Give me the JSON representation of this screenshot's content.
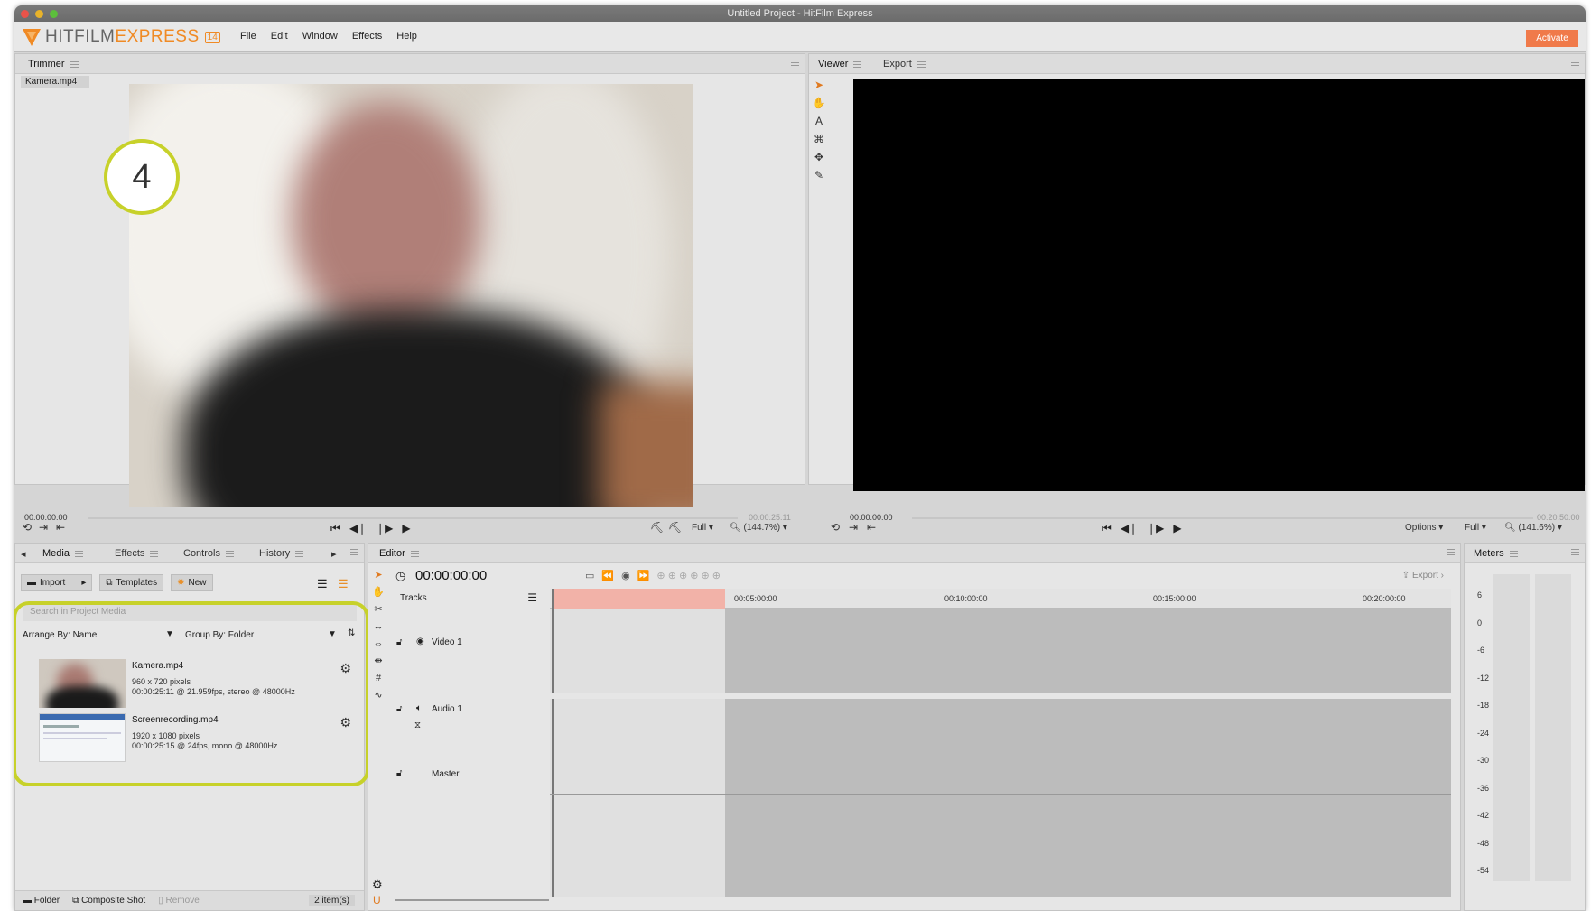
{
  "window": {
    "title": "Untitled Project - HitFilm Express"
  },
  "app": {
    "logo_main": "HITFILM",
    "logo_accent": "EXPRESS",
    "logo_badge": "14"
  },
  "menu": [
    "File",
    "Edit",
    "Window",
    "Effects",
    "Help"
  ],
  "activate_label": "Activate",
  "callout_number": "4",
  "trimmer": {
    "tab": "Trimmer",
    "clip_tab": "Kamera.mp4",
    "start_time": "00:00:00:00",
    "end_time": "00:00:25:11",
    "quality": "Full",
    "zoom": "(144.7%)"
  },
  "viewer": {
    "tab": "Viewer",
    "tab2": "Export",
    "start_time": "00:00:00:00",
    "end_time": "00:20:50:00",
    "options": "Options",
    "quality": "Full",
    "zoom": "(141.6%)"
  },
  "media_panel": {
    "tabs": [
      "Media",
      "Effects",
      "Controls",
      "History"
    ],
    "import": "Import",
    "templates": "Templates",
    "new": "New",
    "search_placeholder": "Search in Project Media",
    "arrange_by": "Arrange By: Name",
    "group_by": "Group By: Folder",
    "items": [
      {
        "name": "Kamera.mp4",
        "line1": "960 x 720 pixels",
        "line2": "00:00:25:11 @ 21.959fps, stereo @ 48000Hz"
      },
      {
        "name": "Screenrecording.mp4",
        "line1": "1920 x 1080 pixels",
        "line2": "00:00:25:15 @ 24fps, mono @ 48000Hz"
      }
    ],
    "footer": {
      "folder": "Folder",
      "composite": "Composite Shot",
      "remove": "Remove",
      "count": "2 item(s)"
    }
  },
  "editor": {
    "tab": "Editor",
    "timecode": "00:00:00:00",
    "export": "Export",
    "tracks_label": "Tracks",
    "tracks": [
      "Video 1",
      "Audio 1",
      "Master"
    ],
    "ruler": [
      "00:05:00:00",
      "00:10:00:00",
      "00:15:00:00",
      "00:20:00:00"
    ]
  },
  "meters": {
    "tab": "Meters",
    "scale": [
      "6",
      "0",
      "-6",
      "-12",
      "-18",
      "-24",
      "-30",
      "-36",
      "-42",
      "-48",
      "-54"
    ]
  }
}
